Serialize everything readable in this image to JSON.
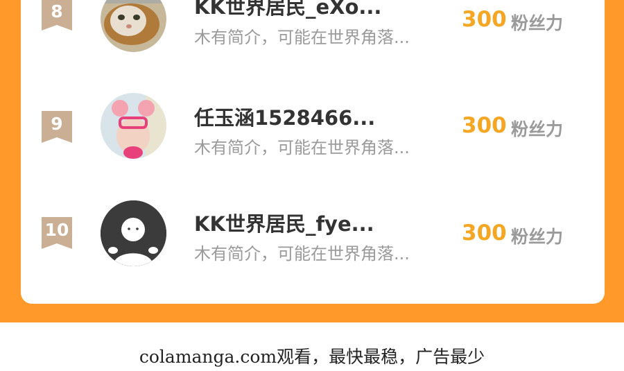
{
  "ranking": {
    "rows": [
      {
        "rank": "8",
        "name": "KK世界居民_eXo...",
        "bio": "木有简介，可能在世界角落...",
        "points": "300",
        "points_unit": "粉丝力",
        "avatar": "cat-avatar"
      },
      {
        "rank": "9",
        "name": "任玉涵1528466...",
        "bio": "木有简介，可能在世界角落...",
        "points": "300",
        "points_unit": "粉丝力",
        "avatar": "child-photo-avatar"
      },
      {
        "rank": "10",
        "name": "KK世界居民_fye...",
        "bio": "木有简介，可能在世界角落...",
        "points": "300",
        "points_unit": "粉丝力",
        "avatar": "default-user-avatar"
      }
    ]
  },
  "footer": {
    "text": "colamanga.com观看，最快最稳，广告最少"
  },
  "colors": {
    "accent_orange": "#FF9A2A",
    "points_gold": "#F5A623",
    "rank_badge": "#CBAF94"
  }
}
